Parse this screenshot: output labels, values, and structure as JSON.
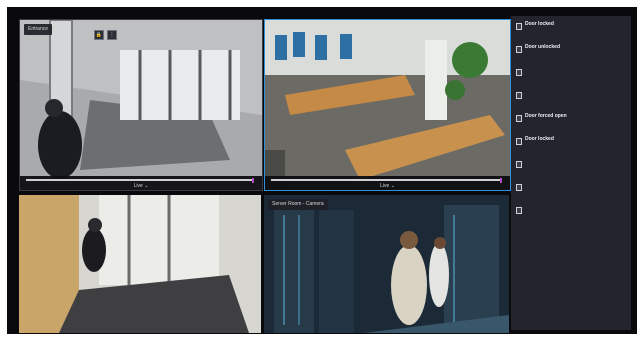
{
  "cameras": [
    {
      "label": "Entrance",
      "sublabel": ""
    },
    {
      "label": "",
      "sublabel": ""
    },
    {
      "label": "",
      "sublabel": ""
    },
    {
      "label": "Server Room - Camera",
      "sublabel": ""
    }
  ],
  "timeline": {
    "live_label": "Live"
  },
  "events": [
    {
      "title": "Door locked",
      "sub": "",
      "sub2": "",
      "time": ""
    },
    {
      "title": "Door unlocked",
      "sub": "",
      "sub2": "",
      "time": ""
    },
    {
      "title": "",
      "sub": "",
      "sub2": "",
      "time": ""
    },
    {
      "title": "",
      "sub": "",
      "sub2": "",
      "time": ""
    },
    {
      "title": "Door forced open",
      "sub": "",
      "sub2": "",
      "time": ""
    },
    {
      "title": "Door locked",
      "sub": "",
      "sub2": "",
      "time": ""
    },
    {
      "title": "",
      "sub": "",
      "sub2": "",
      "time": ""
    },
    {
      "title": "",
      "sub": "",
      "sub2": "",
      "time": ""
    },
    {
      "title": "",
      "sub": "",
      "sub2": "",
      "time": ""
    }
  ],
  "icons": {
    "lock": "lock-icon",
    "more": "more-vertical-icon",
    "chevron": "chevron-down-icon",
    "event": "door-event-icon"
  },
  "colors": {
    "selected_border": "#2f8fd8",
    "scrubber": "#b04cc4",
    "panel_bg": "#22252e"
  }
}
